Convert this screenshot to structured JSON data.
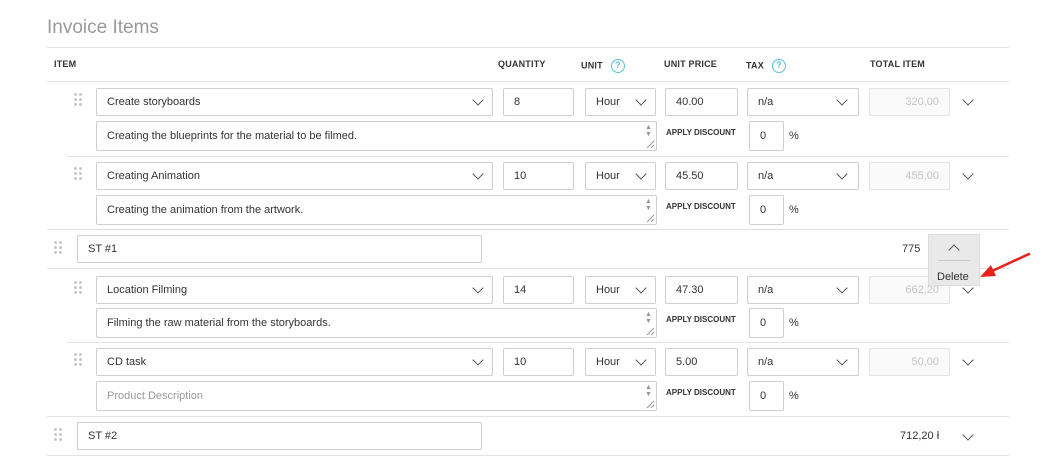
{
  "section_title": "Invoice Items",
  "columns": {
    "item": "ITEM",
    "quantity": "QUANTITY",
    "unit": "UNIT",
    "unit_price": "UNIT PRICE",
    "tax": "TAX",
    "total_item": "TOTAL ITEM",
    "help_glyph": "?"
  },
  "discount_label": "APPLY DISCOUNT",
  "percent_sign": "%",
  "items": [
    {
      "name": "Create storyboards",
      "description": "Creating the blueprints for the material to be filmed.",
      "quantity": "8",
      "unit": "Hour",
      "unit_price": "40.00",
      "tax": "n/a",
      "total": "320,00",
      "discount": "0"
    },
    {
      "name": "Creating Animation",
      "description": "Creating the animation from the artwork.",
      "quantity": "10",
      "unit": "Hour",
      "unit_price": "45.50",
      "tax": "n/a",
      "total": "455,00",
      "discount": "0"
    },
    {
      "name": "Location Filming",
      "description": "Filming the raw material from the storyboards.",
      "quantity": "14",
      "unit": "Hour",
      "unit_price": "47.30",
      "tax": "n/a",
      "total": "662,20",
      "discount": "0"
    },
    {
      "name": "CD task",
      "description_placeholder": "Product Description",
      "quantity": "10",
      "unit": "Hour",
      "unit_price": "5.00",
      "tax": "n/a",
      "total": "50,00",
      "discount": "0"
    }
  ],
  "subtotals": [
    {
      "name": "ST #1",
      "amount": "775"
    },
    {
      "name": "ST #2",
      "amount": "712,20 ł"
    }
  ],
  "context_menu": {
    "delete_label": "Delete"
  },
  "colors": {
    "help_icon": "#5bc0de",
    "annotation_arrow": "#e8201a"
  }
}
